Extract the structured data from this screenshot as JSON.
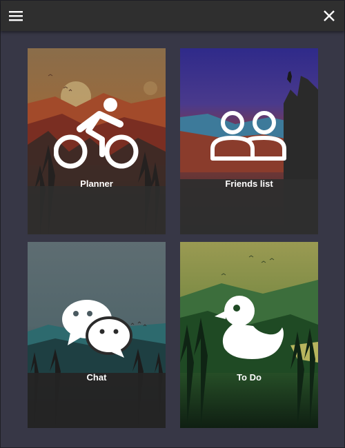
{
  "toolbar": {
    "menu_icon": "hamburger-menu-icon",
    "close_icon": "close-icon"
  },
  "tiles": [
    {
      "label": "Planner",
      "icon": "bicycle-rider-icon"
    },
    {
      "label": "Friends list",
      "icon": "people-icon"
    },
    {
      "label": "Chat",
      "icon": "chat-bubbles-icon"
    },
    {
      "label": "To Do",
      "icon": "duck-icon"
    }
  ],
  "colors": {
    "background": "#373746",
    "topbar": "#2f2f2f",
    "tile_dark": "#2b2b2b",
    "text": "#ffffff"
  }
}
